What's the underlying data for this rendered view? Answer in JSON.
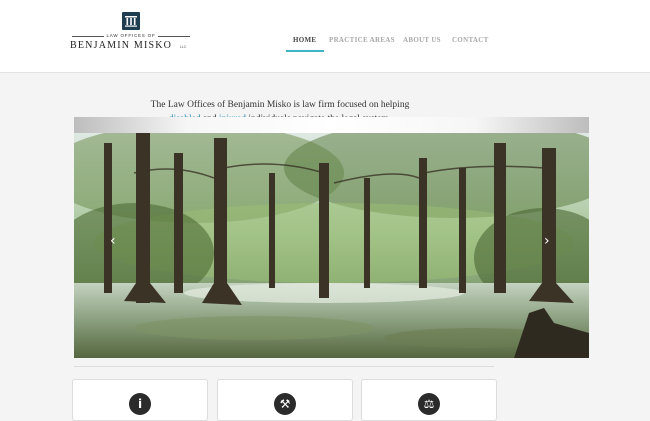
{
  "header": {
    "logo": {
      "small_text": "LAW OFFICES OF",
      "name": "BENJAMIN MISKO",
      "suffix": "LLC"
    },
    "nav": [
      {
        "label": "HOME",
        "active": true
      },
      {
        "label": "PRACTICE AREAS",
        "active": false
      },
      {
        "label": "ABOUT US",
        "active": false
      },
      {
        "label": "CONTACT",
        "active": false
      }
    ]
  },
  "intro": {
    "line1": "The Law Offices of Benjamin Misko is law firm focused on helping",
    "link_disabled": "disabled",
    "and": " and ",
    "link_injured": "injured",
    "line2_rest": " individuals navigate the legal system."
  },
  "slider": {
    "prev_glyph": "‹",
    "next_glyph": "›",
    "image_subject": "cypress swamp with spanish moss"
  },
  "cards": [
    {
      "icon": "info-icon",
      "glyph": "i"
    },
    {
      "icon": "gavel-icon",
      "glyph": "⚒"
    },
    {
      "icon": "scales-icon",
      "glyph": "⚖"
    }
  ],
  "colors": {
    "accent": "#3fb6c3",
    "link": "#2a8fb5",
    "logo": "#1f3d50"
  }
}
